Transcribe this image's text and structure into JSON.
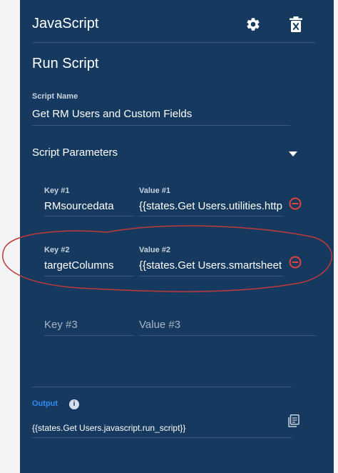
{
  "panel": {
    "title": "JavaScript",
    "section_title": "Run Script"
  },
  "script_name": {
    "label": "Script Name",
    "value": "Get RM Users and Custom Fields"
  },
  "parameters": {
    "heading": "Script Parameters",
    "rows": [
      {
        "key_label": "Key #1",
        "key_value": "RMsourcedata",
        "value_label": "Value #1",
        "value_value": "{{states.Get Users.utilities.http"
      },
      {
        "key_label": "Key #2",
        "key_value": "targetColumns",
        "value_label": "Value #2",
        "value_value": "{{states.Get Users.smartsheet"
      }
    ],
    "new_row": {
      "key_placeholder": "Key #3",
      "value_placeholder": "Value #3"
    }
  },
  "output": {
    "label": "Output",
    "info_glyph": "i",
    "value": "{{states.Get Users.javascript.run_script}}"
  },
  "colors": {
    "panel_bg": "#163a5f",
    "remove_icon": "#e0423e",
    "output_label": "#2e8cf0",
    "annotation": "#c0393b"
  },
  "icons": [
    "gear-icon",
    "trash-icon",
    "chevron-down-icon",
    "remove-circle-icon",
    "info-icon",
    "copy-icon"
  ]
}
